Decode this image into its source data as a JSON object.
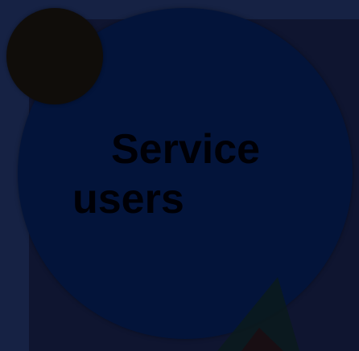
{
  "slide": {
    "title": "Service users"
  },
  "colors": {
    "background": "#162244",
    "panel": "#0f1530",
    "circle": "#03143a",
    "accent_circle": "#100d0a",
    "text": "#000006"
  }
}
